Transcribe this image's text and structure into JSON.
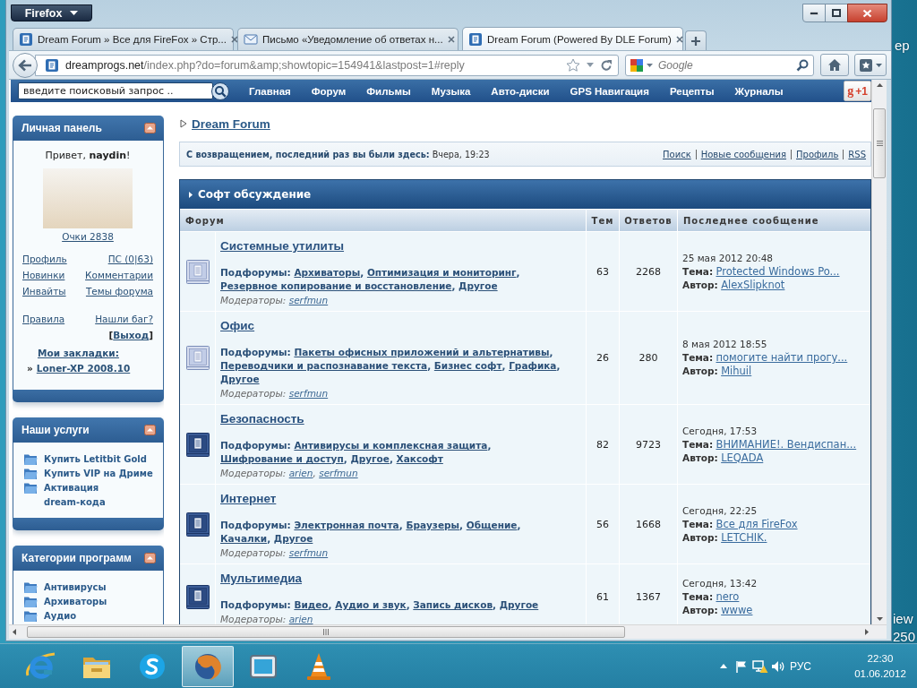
{
  "browser": {
    "menu_button": "Firefox",
    "tabs": [
      {
        "kind": "site",
        "title": "Dream Forum » Все для FireFox » Стр...",
        "selected": false
      },
      {
        "kind": "mail",
        "title": "Письмо «Уведомление об ответах н...",
        "selected": false
      },
      {
        "kind": "site",
        "title": "Dream Forum (Powered By DLE Forum)",
        "selected": true
      }
    ],
    "address": {
      "host": "dreamprogs.net",
      "path": "/index.php?do=forum&amp;showtopic=154941&lastpost=1#reply"
    },
    "search": {
      "placeholder": "Google"
    }
  },
  "site_nav": {
    "search_value": "введите поисковый запрос ..",
    "links": [
      "Главная",
      "Форум",
      "Фильмы",
      "Музыка",
      "Авто-диски",
      "GPS Навигация",
      "Рецепты",
      "Журналы"
    ],
    "plus_one": {
      "logo": "g",
      "label": "+1"
    }
  },
  "sidebar": {
    "panels": [
      {
        "kind": "user",
        "title": "Личная панель",
        "expanded": true,
        "greeting": "Привет, **naydin**!",
        "points": "Очки 2838",
        "link_groups": [
          [
            {
              "left": "Профиль",
              "right": "ПС (0|63)"
            },
            {
              "left": "Новинки",
              "right": "Комментарии"
            },
            {
              "left": "Инвайты",
              "right": "Темы форума"
            }
          ],
          [
            {
              "left": "Правила",
              "right": "Нашли баг?"
            }
          ]
        ],
        "logout": {
          "open": "[",
          "label": "Выход",
          "close": "]"
        },
        "bookmarks_title": "Мои закладки:",
        "bookmarks": [
          {
            "marker": "»",
            "label": "Loner-XP 2008.10"
          }
        ]
      },
      {
        "kind": "folders",
        "title": "Наши услуги",
        "expanded": true,
        "items": [
          "Купить Letitbit Gold",
          "Купить VIP на Дриме",
          "Активация dream-кода"
        ]
      },
      {
        "kind": "folders",
        "title": "Категории программ",
        "expanded": true,
        "items": [
          "Антивирусы",
          "Архиваторы",
          "Аудио"
        ]
      }
    ]
  },
  "breadcrumb": "Dream Forum",
  "welcome": {
    "label": "С возвращением, последний раз вы были здесь:",
    "last_visit": "Вчера, 19:23",
    "links": [
      "Поиск",
      "Новые сообщения",
      "Профиль",
      "RSS"
    ]
  },
  "forum_table": {
    "category": "Софт обсуждение",
    "columns": [
      "Форум",
      "Тем",
      "Ответов",
      "Последнее сообщение"
    ],
    "rows": [
      {
        "title": "Системные утилиты",
        "new_posts": false,
        "subforums_label": "Подфорумы:",
        "subforums": [
          {
            "name": "Архиваторы",
            "punct": ","
          },
          {
            "name": "Оптимизация и мониторинг",
            "punct": ","
          },
          {
            "name": "Резервное копирование и восстановление",
            "punct": ","
          },
          {
            "name": "Другое"
          }
        ],
        "moderators_label": "Модераторы:",
        "moderators": [
          {
            "name": "serfmun"
          }
        ],
        "topics": "63",
        "replies": "2268",
        "last_post": {
          "date": "25 мая 2012 20:48",
          "topic_label": "Тема:",
          "topic": "Protected Windows Po...",
          "author_label": "Автор:",
          "author": "AlexSlipknot"
        }
      },
      {
        "title": "Офис",
        "new_posts": false,
        "subforums_label": "Подфорумы:",
        "subforums": [
          {
            "name": "Пакеты офисных приложений и альтернативы",
            "punct": ","
          },
          {
            "name": "Переводчики и распознавание текста",
            "punct": ","
          },
          {
            "name": "Бизнес софт",
            "punct": ","
          },
          {
            "name": "Графика",
            "punct": ","
          },
          {
            "name": "Другое"
          }
        ],
        "moderators_label": "Модераторы:",
        "moderators": [
          {
            "name": "serfmun"
          }
        ],
        "topics": "26",
        "replies": "280",
        "last_post": {
          "date": "8 мая 2012 18:55",
          "topic_label": "Тема:",
          "topic": "помогите найти прогу...",
          "author_label": "Автор:",
          "author": "Mihuil"
        }
      },
      {
        "title": "Безопасность",
        "new_posts": true,
        "subforums_label": "Подфорумы:",
        "subforums": [
          {
            "name": "Антивирусы и комплексная защита",
            "punct": ","
          },
          {
            "name": "Шифрование и доступ",
            "punct": ","
          },
          {
            "name": "Другое",
            "punct": ","
          },
          {
            "name": "Хаксофт"
          }
        ],
        "moderators_label": "Модераторы:",
        "moderators": [
          {
            "name": "arien",
            "punct": ","
          },
          {
            "name": "serfmun"
          }
        ],
        "topics": "82",
        "replies": "9723",
        "last_post": {
          "date": "Сегодня, 17:53",
          "topic_label": "Тема:",
          "topic": "ВНИМАНИЕ!. Вендиспан...",
          "author_label": "Автор:",
          "author": "LEQADA"
        }
      },
      {
        "title": "Интернет",
        "new_posts": true,
        "subforums_label": "Подфорумы:",
        "subforums": [
          {
            "name": "Электронная почта",
            "punct": ","
          },
          {
            "name": "Браузеры",
            "punct": ","
          },
          {
            "name": "Общение",
            "punct": ","
          },
          {
            "name": "Качалки",
            "punct": ","
          },
          {
            "name": "Другое"
          }
        ],
        "moderators_label": "Модераторы:",
        "moderators": [
          {
            "name": "serfmun"
          }
        ],
        "topics": "56",
        "replies": "1668",
        "last_post": {
          "date": "Сегодня, 22:25",
          "topic_label": "Тема:",
          "topic": "Все для FireFox",
          "author_label": "Автор:",
          "author": "LETCHIK."
        }
      },
      {
        "title": "Мультимедиа",
        "new_posts": true,
        "subforums_label": "Подфорумы:",
        "subforums": [
          {
            "name": "Видео",
            "punct": ","
          },
          {
            "name": "Аудио и звук",
            "punct": ","
          },
          {
            "name": "Запись дисков",
            "punct": ","
          },
          {
            "name": "Другое"
          }
        ],
        "moderators_label": "Модераторы:",
        "moderators": [
          {
            "name": "arien"
          }
        ],
        "topics": "61",
        "replies": "1367",
        "last_post": {
          "date": "Сегодня, 13:42",
          "topic_label": "Тема:",
          "topic": "nero",
          "author_label": "Автор:",
          "author": "wwwe"
        }
      }
    ]
  },
  "taskbar": {
    "apps": [
      {
        "kind": "browser_e",
        "selected": false
      },
      {
        "kind": "files",
        "selected": false
      },
      {
        "kind": "messenger",
        "selected": false
      },
      {
        "kind": "fox_globe",
        "selected": true
      },
      {
        "kind": "window",
        "selected": false
      },
      {
        "kind": "cone",
        "selected": false
      }
    ],
    "language": "РУС",
    "time": "22:30",
    "date": "01.06.2012"
  },
  "desktop": {
    "label_fragments": [
      "ер",
      "iew",
      "250"
    ]
  }
}
